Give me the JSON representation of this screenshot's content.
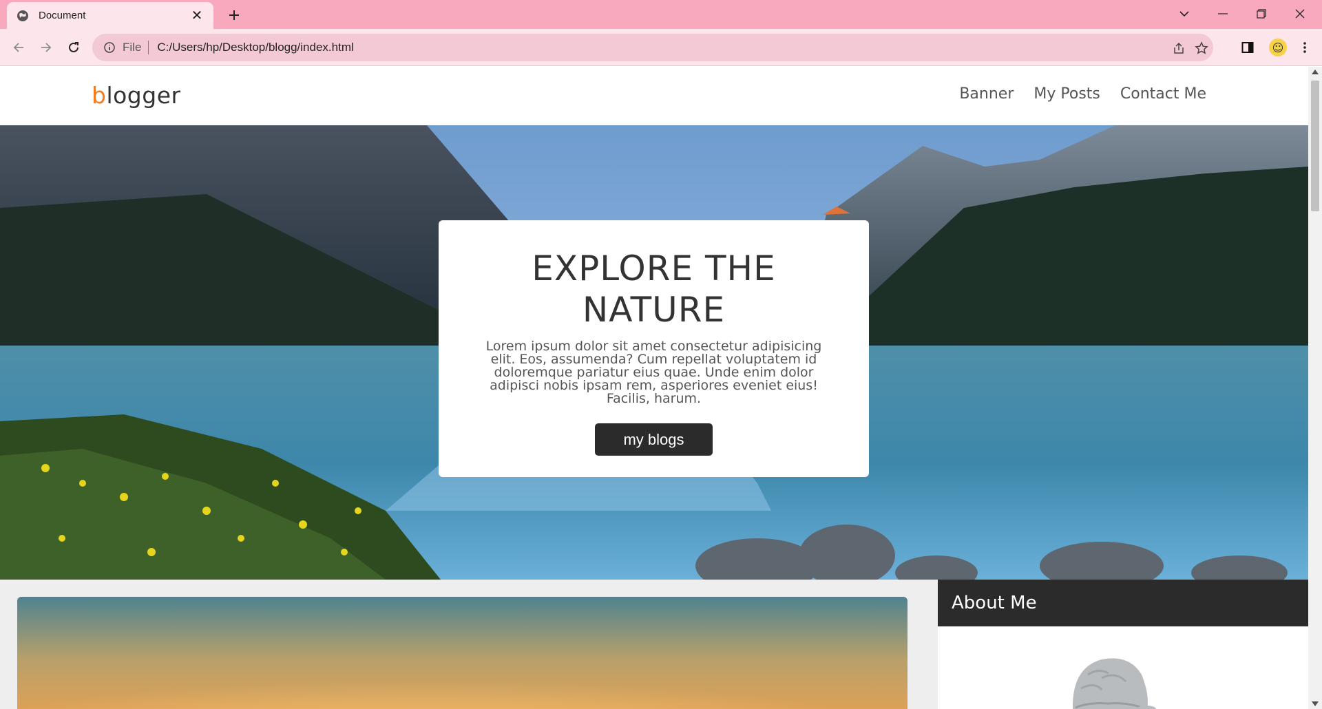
{
  "browser": {
    "tab_title": "Document",
    "url_scheme": "File",
    "url": "C:/Users/hp/Desktop/blogg/index.html"
  },
  "site": {
    "logo_first": "b",
    "logo_rest": "logger",
    "nav": [
      "Banner",
      "My Posts",
      "Contact Me"
    ],
    "hero": {
      "title": "EXPLORE THE NATURE",
      "text": "Lorem ipsum dolor sit amet consectetur adipisicing elit. Eos, assumenda? Cum repellat voluptatem id doloremque pariatur eius quae. Unde enim dolor adipisci nobis ipsam rem, asperiores eveniet eius! Facilis, harum.",
      "button": "my blogs"
    },
    "sidebar": {
      "about_title": "About Me"
    }
  },
  "colors": {
    "titlebar": "#f9a9bd",
    "toolbar": "#fde5ec",
    "logo_accent": "#f07c1e",
    "dark": "#2b2b2b"
  },
  "icons": [
    "globe-icon",
    "close-icon",
    "plus-icon",
    "chevron-down-icon",
    "minimize-icon",
    "restore-icon",
    "back-arrow-icon",
    "forward-arrow-icon",
    "reload-icon",
    "info-icon",
    "share-icon",
    "star-icon",
    "side-panel-icon",
    "profile-avatar-icon",
    "kebab-menu-icon"
  ]
}
